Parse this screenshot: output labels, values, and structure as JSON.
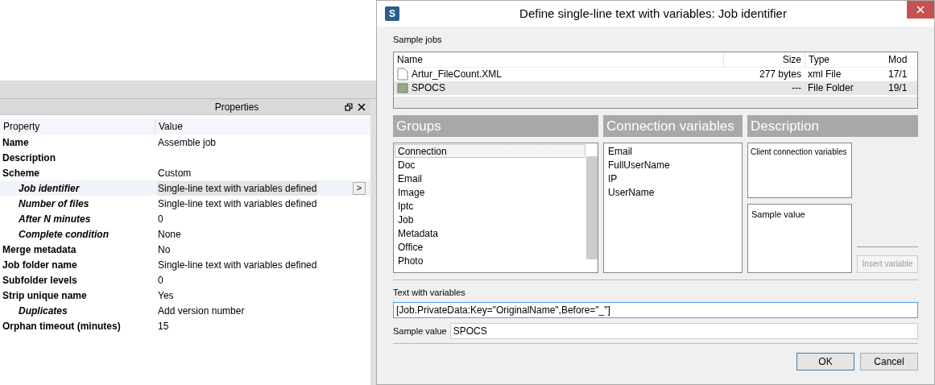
{
  "properties_panel": {
    "title": "Properties",
    "columns": [
      "Property",
      "Value"
    ],
    "rows": [
      {
        "name": "Name",
        "value": "Assemble job",
        "selected": false
      },
      {
        "name": "Description",
        "value": "",
        "selected": false
      },
      {
        "name": "Scheme",
        "value": "Custom",
        "selected": false,
        "children": [
          {
            "name": "Job identifier",
            "value": "Single-line text with variables defined",
            "selected": true,
            "button": ">"
          },
          {
            "name": "Number of files",
            "value": "Single-line text with variables defined",
            "selected": false
          },
          {
            "name": "After N minutes",
            "value": "0",
            "selected": false
          },
          {
            "name": "Complete condition",
            "value": "None",
            "selected": false
          }
        ]
      },
      {
        "name": "Merge metadata",
        "value": "No",
        "selected": false
      },
      {
        "name": "Job folder name",
        "value": "Single-line text with variables defined",
        "selected": false
      },
      {
        "name": "Subfolder levels",
        "value": "0",
        "selected": false
      },
      {
        "name": "Strip unique name",
        "value": "Yes",
        "selected": false,
        "children": [
          {
            "name": "Duplicates",
            "value": "Add version number",
            "selected": false
          }
        ]
      },
      {
        "name": "Orphan timeout (minutes)",
        "value": "15",
        "selected": false
      }
    ]
  },
  "dialog": {
    "app_icon": "S",
    "title": "Define single-line text with variables: Job identifier",
    "sample_jobs": {
      "label": "Sample jobs",
      "columns": [
        "Name",
        "Size",
        "Type",
        "Mod"
      ],
      "rows": [
        {
          "kind": "file",
          "name": "Artur_FileCount.XML",
          "size": "277 bytes",
          "type": "xml File",
          "modified": "17/1",
          "selected": false
        },
        {
          "kind": "folder",
          "name": "SPOCS",
          "size": "---",
          "type": "File Folder",
          "modified": "19/1",
          "selected": true
        }
      ]
    },
    "groups": {
      "title": "Groups",
      "items": [
        {
          "label": "Connection",
          "selected": true
        },
        {
          "label": "Doc",
          "selected": false
        },
        {
          "label": "Email",
          "selected": false
        },
        {
          "label": "Image",
          "selected": false
        },
        {
          "label": "Iptc",
          "selected": false
        },
        {
          "label": "Job",
          "selected": false
        },
        {
          "label": "Metadata",
          "selected": false
        },
        {
          "label": "Office",
          "selected": false
        },
        {
          "label": "Photo",
          "selected": false
        }
      ]
    },
    "variables": {
      "title": "Connection variables",
      "items": [
        {
          "label": "Email",
          "selected": false
        },
        {
          "label": "FullUserName",
          "selected": false
        },
        {
          "label": "IP",
          "selected": false
        },
        {
          "label": "UserName",
          "selected": false
        }
      ]
    },
    "description": {
      "title": "Description",
      "text": "Client connection variables",
      "sample_value": "Sample value"
    },
    "insert_button": {
      "label": "Insert variable",
      "disabled": true
    },
    "text_with_variables": {
      "label": "Text with variables",
      "value": "[Job.PrivateData:Key=\"OriginalName\",Before=\"_\"]"
    },
    "sample_value": {
      "label": "Sample value",
      "value": "SPOCS"
    },
    "buttons": [
      "OK",
      "Cancel"
    ]
  }
}
